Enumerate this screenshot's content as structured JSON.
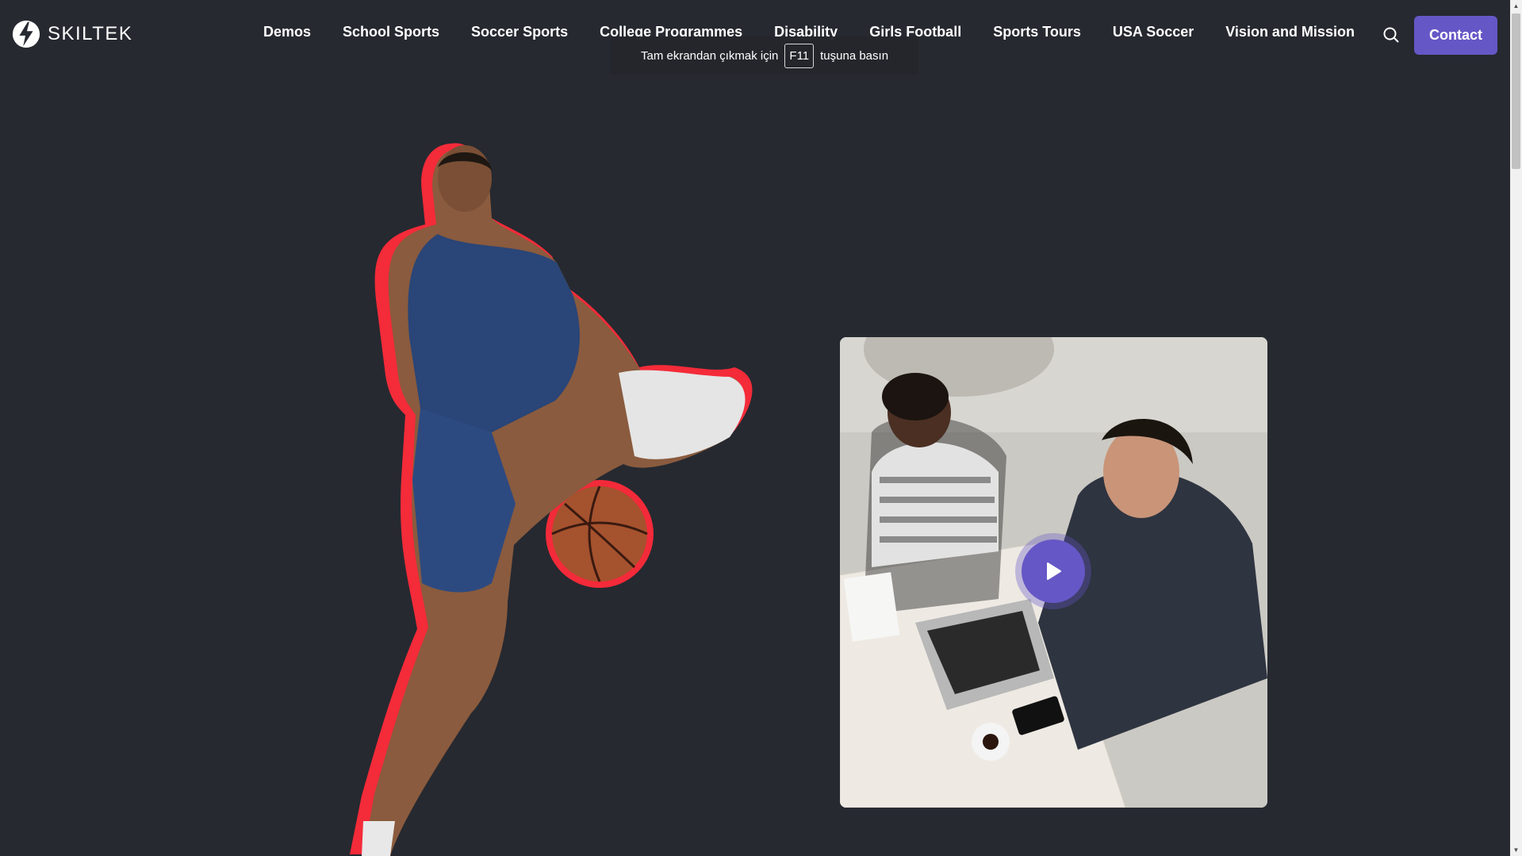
{
  "brand": {
    "name": "SKILTEK"
  },
  "nav": {
    "items": [
      {
        "label": "Demos"
      },
      {
        "label": "School Sports"
      },
      {
        "label": "Soccer Sports"
      },
      {
        "label": "College Programmes"
      },
      {
        "label": "Disability"
      },
      {
        "label": "Girls Football"
      },
      {
        "label": "Sports Tours"
      },
      {
        "label": "USA Soccer"
      },
      {
        "label": "Vision and Mission"
      }
    ]
  },
  "header": {
    "search_icon": "search-icon",
    "contact_label": "Contact"
  },
  "fullscreen_notice": {
    "before": "Tam ekrandan çıkmak için",
    "key": "F11",
    "after": "tuşuna basın"
  },
  "hero": {
    "figure": "basketball-player-image",
    "video": {
      "thumbnail": "meeting-photo",
      "play_icon": "play-icon"
    }
  },
  "colors": {
    "background": "#262930",
    "accent": "#6557c6",
    "outline_red": "#ff2b3a"
  }
}
